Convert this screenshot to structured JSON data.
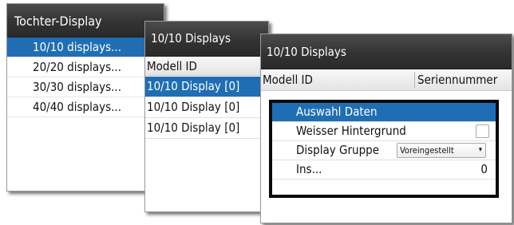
{
  "window_tochter": {
    "title": "Tochter-Display",
    "items": [
      {
        "label": "10/10 displays..."
      },
      {
        "label": "20/20 displays..."
      },
      {
        "label": "30/30 displays..."
      },
      {
        "label": "40/40 displays..."
      }
    ],
    "selected_index": 0
  },
  "window_displays_list": {
    "title": "10/10 Displays",
    "column_header": "Modell ID",
    "rows": [
      {
        "label": "10/10 Display [0]"
      },
      {
        "label": "10/10 Display [0]"
      },
      {
        "label": "10/10 Display [0]"
      }
    ],
    "selected_index": 0
  },
  "window_displays_detail": {
    "title": "10/10 Displays",
    "columns": [
      "Modell ID",
      "Seriennummer"
    ],
    "context_menu": {
      "items": [
        {
          "label": "Auswahl Daten"
        },
        {
          "label": "Weisser Hintergrund",
          "checked": false
        },
        {
          "label": "Display Gruppe",
          "select_value": "Voreingestellt"
        },
        {
          "label": "Ins...",
          "value": "0"
        }
      ],
      "selected_index": 0
    }
  },
  "colors": {
    "selection": "#1f6eb4",
    "titlebar": "#333333",
    "menu_border": "#0a0a0a"
  },
  "icons": {
    "dropdown_arrow": "▾"
  }
}
